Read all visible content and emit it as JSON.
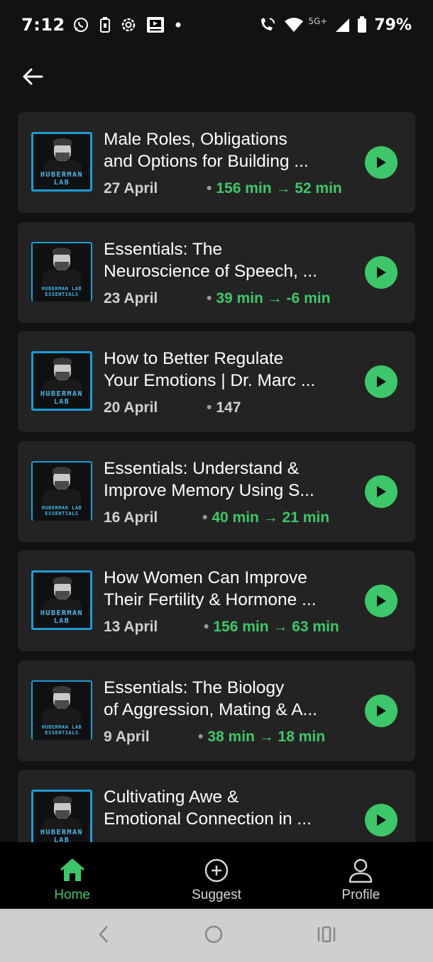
{
  "status_bar": {
    "time": "7:12",
    "network": "5G+",
    "battery": "79%"
  },
  "episodes": [
    {
      "title_line1": "Male Roles, Obligations",
      "title_line2": "and Options for Building ...",
      "date": "27 April",
      "duration": "156 min → 52 min",
      "thumb_type": "lab",
      "logo_line1": "HUBERMAN",
      "logo_line2": "LAB"
    },
    {
      "title_line1": "Essentials: The",
      "title_line2": "Neuroscience of Speech, ...",
      "date": "23 April",
      "duration": "39 min → -6 min",
      "thumb_type": "essentials",
      "logo_line1": "HUBERMAN LAB",
      "logo_line2": "ESSENTIALS"
    },
    {
      "title_line1": "How to Better Regulate",
      "title_line2": "Your Emotions | Dr. Marc ...",
      "date": "20 April",
      "duration": "147",
      "thumb_type": "lab",
      "logo_line1": "HUBERMAN",
      "logo_line2": "LAB"
    },
    {
      "title_line1": "Essentials: Understand &",
      "title_line2": "Improve Memory Using S...",
      "date": "16 April",
      "duration": "40 min → 21 min",
      "thumb_type": "essentials",
      "logo_line1": "HUBERMAN LAB",
      "logo_line2": "ESSENTIALS"
    },
    {
      "title_line1": "How Women Can Improve",
      "title_line2": "Their Fertility & Hormone ...",
      "date": "13 April",
      "duration": "156 min → 63 min",
      "thumb_type": "lab",
      "logo_line1": "HUBERMAN",
      "logo_line2": "LAB"
    },
    {
      "title_line1": "Essentials: The Biology",
      "title_line2": "of Aggression, Mating & A...",
      "date": "9 April",
      "duration": "38 min → 18 min",
      "thumb_type": "essentials",
      "logo_line1": "HUBERMAN LAB",
      "logo_line2": "ESSENTIALS"
    },
    {
      "title_line1": "Cultivating Awe &",
      "title_line2": "Emotional Connection in ...",
      "date": "",
      "duration": "",
      "thumb_type": "lab",
      "logo_line1": "HUBERMAN",
      "logo_line2": "LAB"
    }
  ],
  "bottom_nav": {
    "home": "Home",
    "suggest": "Suggest",
    "profile": "Profile"
  },
  "colors": {
    "accent": "#3ec76a",
    "card_bg": "#232323",
    "page_bg": "#121212"
  }
}
